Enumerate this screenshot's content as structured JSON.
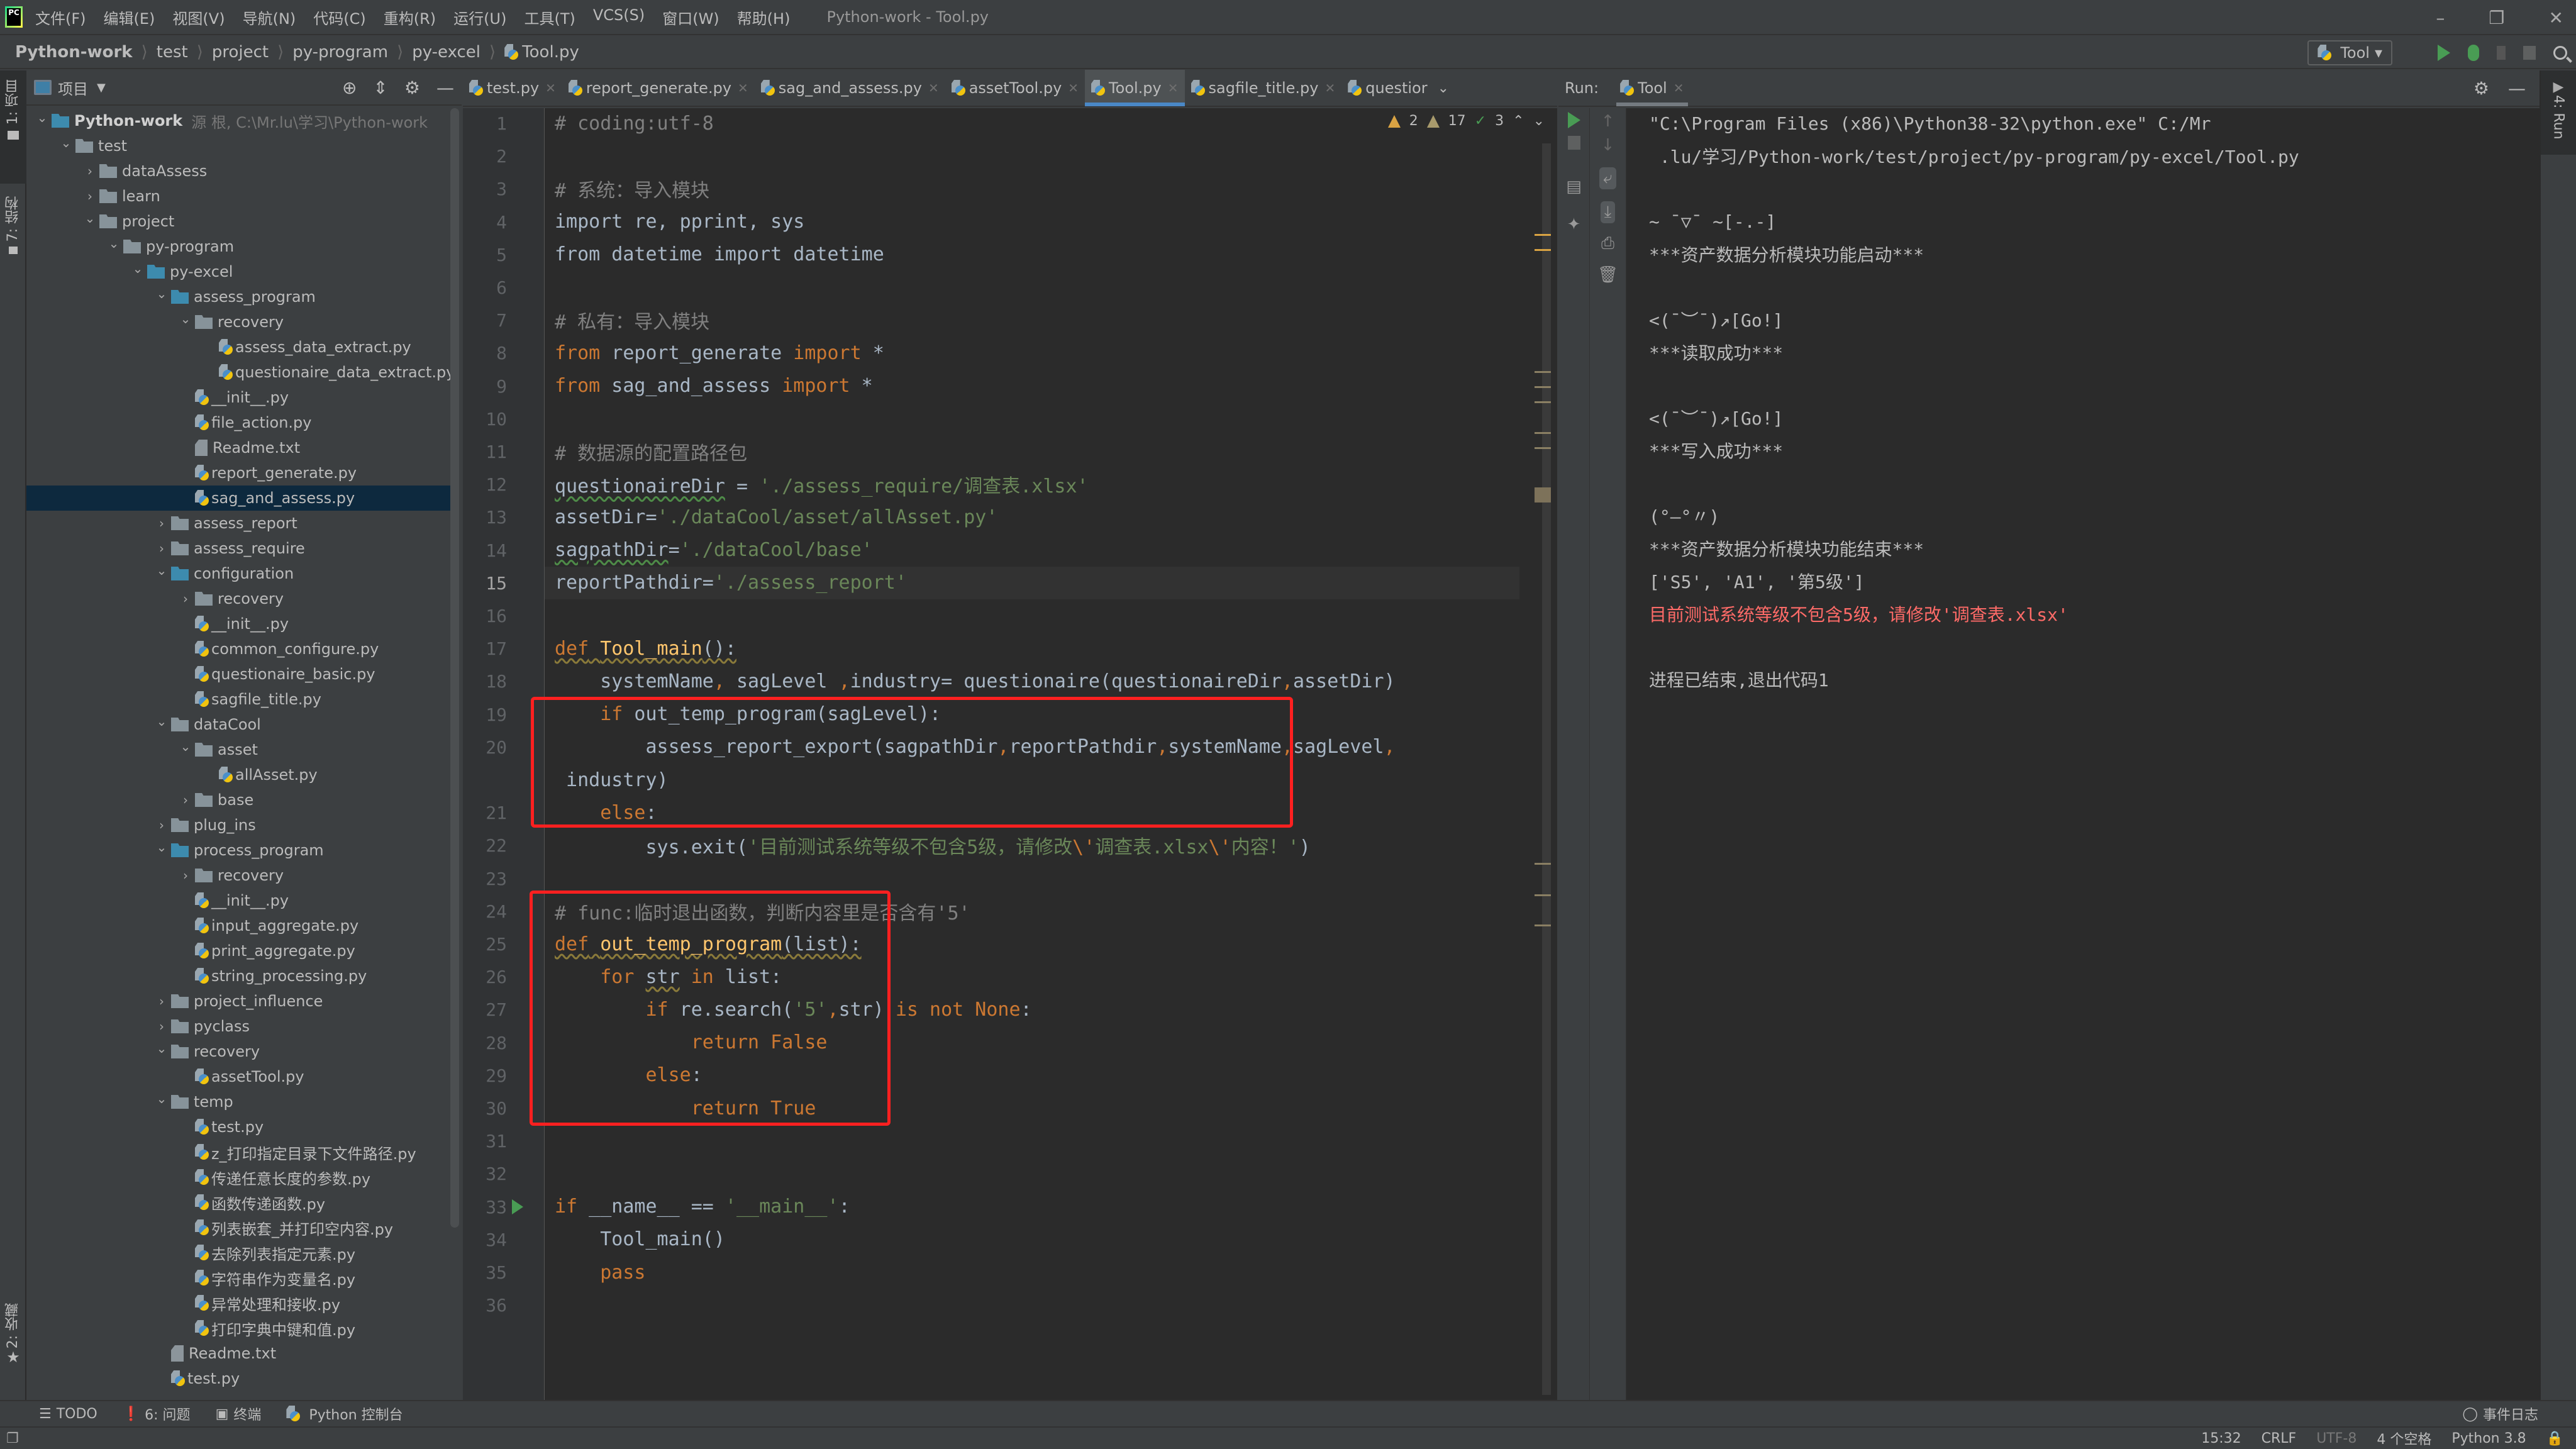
{
  "menubar": {
    "items": [
      "文件(F)",
      "编辑(E)",
      "视图(V)",
      "导航(N)",
      "代码(C)",
      "重构(R)",
      "运行(U)",
      "工具(T)",
      "VCS(S)",
      "窗口(W)",
      "帮助(H)"
    ],
    "window_title": "Python-work - Tool.py",
    "controls": {
      "minimize": "–",
      "restore": "❐",
      "close": "✕"
    }
  },
  "breadcrumb": [
    "Python-work",
    "test",
    "project",
    "py-program",
    "py-excel",
    "Tool.py"
  ],
  "run_config": {
    "name": "Tool",
    "dropdown": "▾"
  },
  "left_strip": {
    "project_tab": "1: 项目",
    "structure_tab": "7: 结构",
    "favorites_tab": "2: 收藏"
  },
  "project_panel": {
    "title": "项目",
    "root_hint": "源 根, C:\\Mr.lu\\学习\\Python-work",
    "tree": [
      {
        "label": "Python-work",
        "depth": 0,
        "type": "folder-blue",
        "expanded": true,
        "bold": true
      },
      {
        "label": "test",
        "depth": 1,
        "type": "folder",
        "expanded": true
      },
      {
        "label": "dataAssess",
        "depth": 2,
        "type": "folder",
        "expanded": false
      },
      {
        "label": "learn",
        "depth": 2,
        "type": "folder",
        "expanded": false
      },
      {
        "label": "project",
        "depth": 2,
        "type": "folder",
        "expanded": true
      },
      {
        "label": "py-program",
        "depth": 3,
        "type": "folder",
        "expanded": true
      },
      {
        "label": "py-excel",
        "depth": 4,
        "type": "folder-blue",
        "expanded": true
      },
      {
        "label": "assess_program",
        "depth": 5,
        "type": "folder-blue",
        "expanded": true
      },
      {
        "label": "recovery",
        "depth": 6,
        "type": "folder",
        "expanded": true
      },
      {
        "label": "assess_data_extract.py",
        "depth": 7,
        "type": "py"
      },
      {
        "label": "questionaire_data_extract.py",
        "depth": 7,
        "type": "py"
      },
      {
        "label": "__init__.py",
        "depth": 6,
        "type": "py"
      },
      {
        "label": "file_action.py",
        "depth": 6,
        "type": "py"
      },
      {
        "label": "Readme.txt",
        "depth": 6,
        "type": "txt"
      },
      {
        "label": "report_generate.py",
        "depth": 6,
        "type": "py"
      },
      {
        "label": "sag_and_assess.py",
        "depth": 6,
        "type": "py",
        "selected": true
      },
      {
        "label": "assess_report",
        "depth": 5,
        "type": "folder",
        "expanded": false
      },
      {
        "label": "assess_require",
        "depth": 5,
        "type": "folder",
        "expanded": false
      },
      {
        "label": "configuration",
        "depth": 5,
        "type": "folder-blue",
        "expanded": true
      },
      {
        "label": "recovery",
        "depth": 6,
        "type": "folder",
        "expanded": false
      },
      {
        "label": "__init__.py",
        "depth": 6,
        "type": "py"
      },
      {
        "label": "common_configure.py",
        "depth": 6,
        "type": "py"
      },
      {
        "label": "questionaire_basic.py",
        "depth": 6,
        "type": "py"
      },
      {
        "label": "sagfile_title.py",
        "depth": 6,
        "type": "py"
      },
      {
        "label": "dataCool",
        "depth": 5,
        "type": "folder",
        "expanded": true
      },
      {
        "label": "asset",
        "depth": 6,
        "type": "folder",
        "expanded": true
      },
      {
        "label": "allAsset.py",
        "depth": 7,
        "type": "py"
      },
      {
        "label": "base",
        "depth": 6,
        "type": "folder",
        "expanded": false
      },
      {
        "label": "plug_ins",
        "depth": 5,
        "type": "folder-pkg",
        "expanded": false
      },
      {
        "label": "process_program",
        "depth": 5,
        "type": "folder-blue",
        "expanded": true
      },
      {
        "label": "recovery",
        "depth": 6,
        "type": "folder",
        "expanded": false
      },
      {
        "label": "__init__.py",
        "depth": 6,
        "type": "py"
      },
      {
        "label": "input_aggregate.py",
        "depth": 6,
        "type": "py"
      },
      {
        "label": "print_aggregate.py",
        "depth": 6,
        "type": "py"
      },
      {
        "label": "string_processing.py",
        "depth": 6,
        "type": "py"
      },
      {
        "label": "project_influence",
        "depth": 5,
        "type": "folder",
        "expanded": false
      },
      {
        "label": "pyclass",
        "depth": 5,
        "type": "folder-pkg",
        "expanded": false
      },
      {
        "label": "recovery",
        "depth": 5,
        "type": "folder",
        "expanded": true
      },
      {
        "label": "assetTool.py",
        "depth": 6,
        "type": "py"
      },
      {
        "label": "temp",
        "depth": 5,
        "type": "folder",
        "expanded": true
      },
      {
        "label": "test.py",
        "depth": 6,
        "type": "py"
      },
      {
        "label": "z_打印指定目录下文件路径.py",
        "depth": 6,
        "type": "py"
      },
      {
        "label": "传递任意长度的参数.py",
        "depth": 6,
        "type": "py"
      },
      {
        "label": "函数传递函数.py",
        "depth": 6,
        "type": "py"
      },
      {
        "label": "列表嵌套_并打印空内容.py",
        "depth": 6,
        "type": "py"
      },
      {
        "label": "去除列表指定元素.py",
        "depth": 6,
        "type": "py"
      },
      {
        "label": "字符串作为变量名.py",
        "depth": 6,
        "type": "py"
      },
      {
        "label": "异常处理和接收.py",
        "depth": 6,
        "type": "py"
      },
      {
        "label": "打印字典中键和值.py",
        "depth": 6,
        "type": "py"
      },
      {
        "label": "Readme.txt",
        "depth": 5,
        "type": "txt"
      },
      {
        "label": "test.py",
        "depth": 5,
        "type": "py"
      }
    ]
  },
  "editor_tabs": [
    {
      "label": "test.py",
      "active": false
    },
    {
      "label": "report_generate.py",
      "active": false
    },
    {
      "label": "sag_and_assess.py",
      "active": false
    },
    {
      "label": "assetTool.py",
      "active": false
    },
    {
      "label": "Tool.py",
      "active": true
    },
    {
      "label": "sagfile_title.py",
      "active": false
    },
    {
      "label": "questior",
      "active": false
    }
  ],
  "inspections": {
    "warnings": "2",
    "weak_warnings": "17",
    "typos": "3"
  },
  "editor": {
    "current_line": 15,
    "lines": [
      {
        "n": "1",
        "html": "<span class='c-com'># coding:utf-8</span>"
      },
      {
        "n": "2",
        "html": ""
      },
      {
        "n": "3",
        "html": "<span class='c-com'># 系统：导入模块</span>"
      },
      {
        "n": "4",
        "html": "import re, pprint, sys"
      },
      {
        "n": "5",
        "html": "from datetime import datetime"
      },
      {
        "n": "6",
        "html": ""
      },
      {
        "n": "7",
        "html": "<span class='c-com'># 私有：导入模块</span>"
      },
      {
        "n": "8",
        "html": "<span class='c-kw'>from</span> report_generate <span class='c-kw'>import</span> *"
      },
      {
        "n": "9",
        "html": "<span class='c-kw'>from</span> sag_and_assess <span class='c-kw'>import</span> *"
      },
      {
        "n": "10",
        "html": ""
      },
      {
        "n": "11",
        "html": "<span class='c-com'># 数据源的配置路径包</span>"
      },
      {
        "n": "12",
        "html": "<span class='wavy'>questionaireDir</span> = <span class='c-str'>'./assess_require/调查表.xlsx'</span>"
      },
      {
        "n": "13",
        "html": "assetDir=<span class='c-str'>'./dataCool/asset/allAsset.py'</span>"
      },
      {
        "n": "14",
        "html": "<span class='wavy'>sagpathDir</span>=<span class='c-str'>'./dataCool/base'</span>"
      },
      {
        "n": "15",
        "html": "reportPathdir=<span class='c-str'>'./assess_report'</span>"
      },
      {
        "n": "16",
        "html": ""
      },
      {
        "n": "17",
        "html": "<span class='wavy-y'><span class='c-kw'>def</span> <span class='c-fn'>Tool_main</span>():</span>"
      },
      {
        "n": "18",
        "html": "    systemName<span class='c-kw'>,</span> sagLevel <span class='c-kw'>,</span>industry= questionaire(questionaireDir<span class='c-kw'>,</span>assetDir)"
      },
      {
        "n": "19",
        "html": "    <span class='c-kw'>if</span> out_temp_program(sagLevel):"
      },
      {
        "n": "20",
        "html": "        assess_report_export(sagpathDir<span class='c-kw'>,</span>reportPathdir<span class='c-kw'>,</span>systemName<span class='c-kw'>,</span>sagLevel<span class='c-kw'>,</span>"
      },
      {
        "n": "",
        "html": " industry)"
      },
      {
        "n": "21",
        "html": "    <span class='c-kw'>else</span>:"
      },
      {
        "n": "22",
        "html": "        sys.exit(<span class='c-str'>'目前测试系统等级不包含5级，请修改<span class='c-esc'>\\'</span>调查表.xlsx<span class='c-esc'>\\'</span>内容！'</span>)"
      },
      {
        "n": "23",
        "html": ""
      },
      {
        "n": "24",
        "html": "<span class='c-com'># func:临时退出函数，判断内容里是否含有'5'</span>"
      },
      {
        "n": "25",
        "html": "<span class='wavy-y'><span class='c-kw'>def</span> <span class='c-fn'>out_temp_program</span>(list):</span>"
      },
      {
        "n": "26",
        "html": "    <span class='c-kw'>for</span> <span class='wavy-y'>str</span> <span class='c-kw'>in</span> list:"
      },
      {
        "n": "27",
        "html": "        <span class='c-kw'>if</span> re.search(<span class='c-str'>'5'</span><span class='c-kw'>,</span>str) <span class='c-kw'>is not None</span>:"
      },
      {
        "n": "28",
        "html": "            <span class='c-kw'>return False</span>"
      },
      {
        "n": "29",
        "html": "        <span class='c-kw'>else</span>:"
      },
      {
        "n": "30",
        "html": "            <span class='c-kw'>return True</span>"
      },
      {
        "n": "31",
        "html": ""
      },
      {
        "n": "32",
        "html": ""
      },
      {
        "n": "33",
        "html": "<span class='c-kw'>if</span> __name__ == <span class='c-str'>'__main__'</span>:"
      },
      {
        "n": "34",
        "html": "    Tool_main()"
      },
      {
        "n": "35",
        "html": "    <span class='c-kw'>pass</span>"
      },
      {
        "n": "36",
        "html": ""
      }
    ]
  },
  "run_panel": {
    "label": "Run:",
    "tab": "Tool",
    "output": [
      {
        "text": "\"C:\\Program Files (x86)\\Python38-32\\python.exe\" C:/Mr",
        "err": false
      },
      {
        "text": " .lu/学习/Python-work/test/project/py-program/py-excel/Tool.py",
        "err": false
      },
      {
        "text": "",
        "err": false
      },
      {
        "text": "~ ¯▽¯ ~[-.-]",
        "err": false
      },
      {
        "text": "***资产数据分析模块功能启动***",
        "err": false
      },
      {
        "text": "",
        "err": false
      },
      {
        "text": "<(¯︶¯)↗[Go!]",
        "err": false
      },
      {
        "text": "***读取成功***",
        "err": false
      },
      {
        "text": "",
        "err": false
      },
      {
        "text": "<(¯︶¯)↗[Go!]",
        "err": false
      },
      {
        "text": "***写入成功***",
        "err": false
      },
      {
        "text": "",
        "err": false
      },
      {
        "text": "(°—°〃)",
        "err": false
      },
      {
        "text": "***资产数据分析模块功能结束***",
        "err": false
      },
      {
        "text": "['S5', 'A1', '第5级']",
        "err": false
      },
      {
        "text": "目前测试系统等级不包含5级，请修改'调查表.xlsx'",
        "err": true
      },
      {
        "text": "",
        "err": false
      },
      {
        "text": "进程已结束,退出代码1",
        "err": false
      }
    ],
    "right_tab": "4: Run"
  },
  "bottom_tools": {
    "todo": "TODO",
    "problems": "6: 问题",
    "terminal": "终端",
    "python_console": "Python 控制台",
    "event_log": "事件日志"
  },
  "statusbar": {
    "position": "15:32",
    "line_sep": "CRLF",
    "encoding": "UTF-8",
    "indent": "4 个空格",
    "interpreter": "Python 3.8"
  },
  "colors": {
    "editor_bg": "#2b2b2b",
    "chrome_bg": "#3c3f41",
    "keyword": "#cc7832",
    "string": "#6a8759",
    "comment": "#808080",
    "function": "#ffc66d",
    "highlight_box": "#ff2020",
    "error_output": "#ff6b68",
    "active_tab_underline": "#4a88c7"
  }
}
